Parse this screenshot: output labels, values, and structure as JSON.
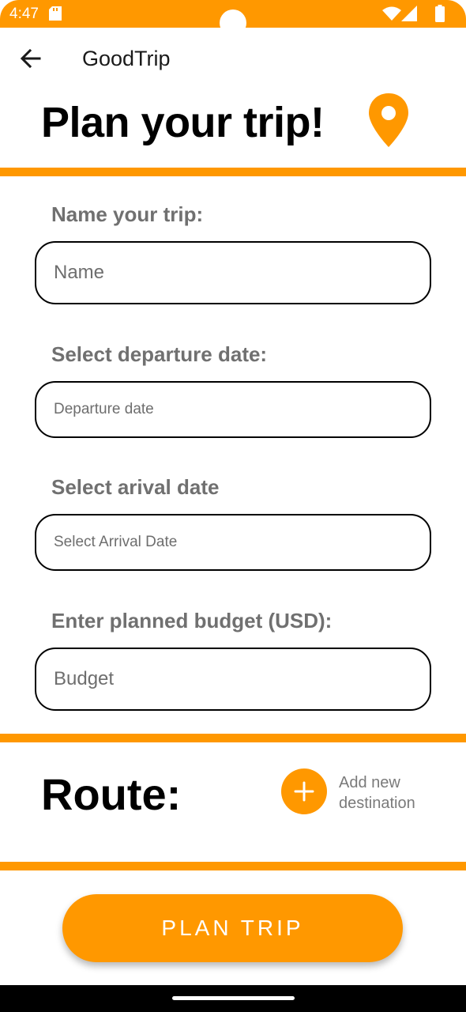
{
  "status_bar": {
    "time": "4:47",
    "background": "#FF9800",
    "icons": [
      "sd-card-icon",
      "wifi-icon",
      "cell-signal-icon",
      "battery-icon"
    ]
  },
  "app_bar": {
    "back_icon": "arrow-back-icon",
    "title": "GoodTrip"
  },
  "header": {
    "title": "Plan your trip!",
    "icon": "location-pin-icon"
  },
  "form": {
    "name": {
      "label": "Name your trip:",
      "placeholder": "Name"
    },
    "departure": {
      "label": "Select departure date:",
      "placeholder": "Departure date"
    },
    "arrival": {
      "label": "Select arival date",
      "placeholder": "Select Arrival Date"
    },
    "budget": {
      "label": "Enter planned budget (USD):",
      "placeholder": "Budget"
    }
  },
  "route": {
    "title": "Route:",
    "add_icon": "plus-icon",
    "add_label": "Add new destination"
  },
  "actions": {
    "plan_label": "PLAN TRIP"
  },
  "colors": {
    "accent": "#FF9800",
    "label_gray": "#707070",
    "hint_gray": "#6e6e6e"
  }
}
